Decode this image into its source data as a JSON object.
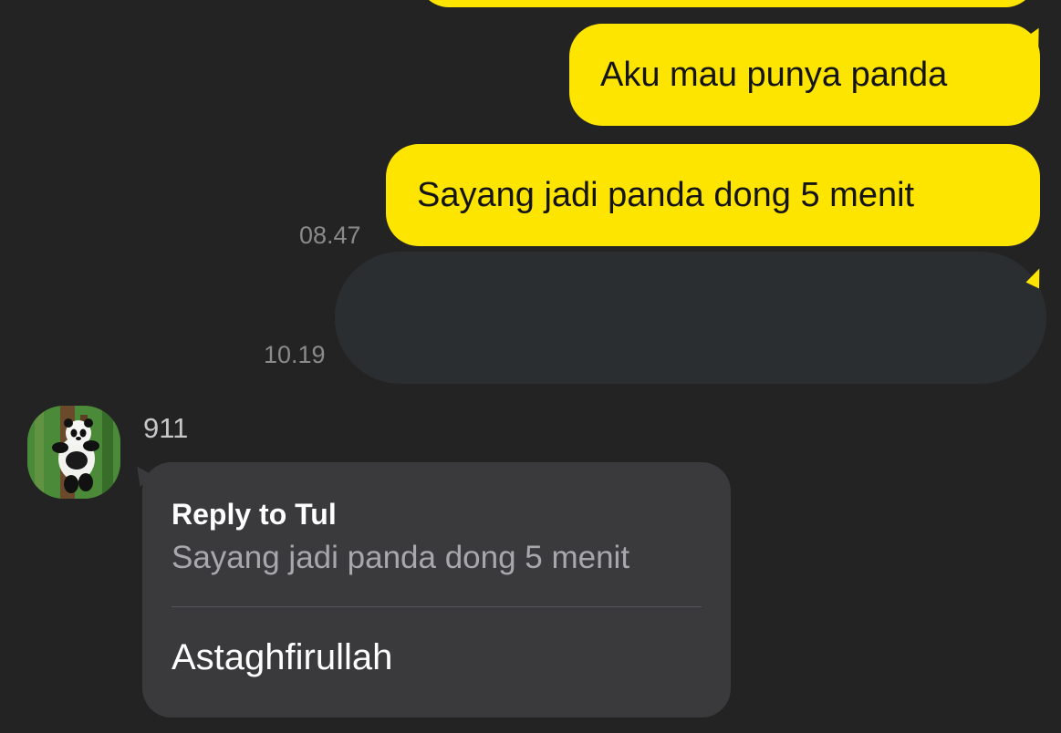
{
  "chat": {
    "outgoing": [
      {
        "text": "Aku mau punya panda"
      },
      {
        "text": "Sayang jadi panda dong 5 menit",
        "time": "08.47"
      },
      {
        "text": "",
        "time": "10.19"
      }
    ],
    "incoming": {
      "sender": "911",
      "avatar_icon": "panda-avatar",
      "reply_to": "Reply to Tul",
      "quoted_text": "Sayang jadi panda dong 5 menit",
      "message": "Astaghfirullah"
    }
  },
  "colors": {
    "background": "#232324",
    "outgoing_bubble": "#FEE500",
    "outgoing_text": "#141414",
    "incoming_bubble": "#3A3A3C",
    "dark_bubble": "#2B2E31",
    "timestamp": "#8A8A8C"
  }
}
